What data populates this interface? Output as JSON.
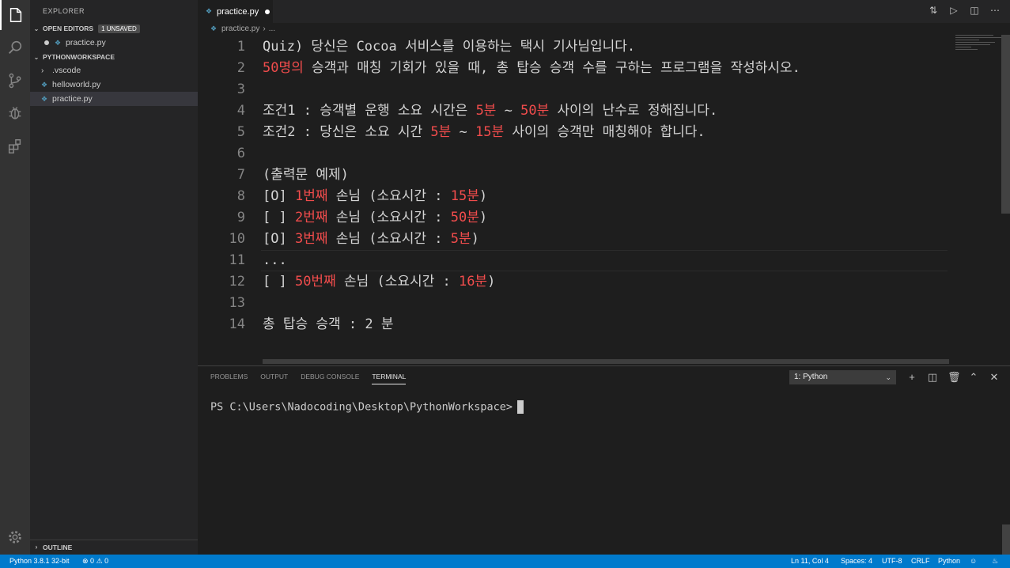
{
  "sidebar": {
    "title": "EXPLORER",
    "open_editors": {
      "label": "OPEN EDITORS",
      "badge": "1 UNSAVED",
      "files": [
        "practice.py"
      ]
    },
    "workspace": {
      "label": "PYTHONWORKSPACE",
      "items": [
        {
          "name": ".vscode",
          "type": "folder"
        },
        {
          "name": "helloworld.py",
          "type": "file"
        },
        {
          "name": "practice.py",
          "type": "file",
          "selected": true
        }
      ]
    },
    "outline_label": "OUTLINE"
  },
  "tab": {
    "label": "practice.py",
    "unsaved": true
  },
  "breadcrumb": {
    "file": "practice.py",
    "more": "..."
  },
  "editor": {
    "lines": [
      {
        "n": "1",
        "parts": [
          {
            "t": "Quiz) 당신은 Cocoa 서비스를 이용하는 택시 기사님입니다."
          }
        ]
      },
      {
        "n": "2",
        "parts": [
          {
            "t": "50명의",
            "hl": true
          },
          {
            "t": " 승객과 매칭 기회가 있을 때, 총 탑승 승객 수를 구하는 프로그램을 작성하시오."
          }
        ]
      },
      {
        "n": "3",
        "parts": []
      },
      {
        "n": "4",
        "parts": [
          {
            "t": "조건1 : 승객별 운행 소요 시간은 "
          },
          {
            "t": "5분",
            "hl": true
          },
          {
            "t": " ~ "
          },
          {
            "t": "50분",
            "hl": true
          },
          {
            "t": " 사이의 난수로 정해집니다."
          }
        ]
      },
      {
        "n": "5",
        "parts": [
          {
            "t": "조건2 : 당신은 소요 시간 "
          },
          {
            "t": "5분",
            "hl": true
          },
          {
            "t": " ~ "
          },
          {
            "t": "15분",
            "hl": true
          },
          {
            "t": " 사이의 승객만 매칭해야 합니다."
          }
        ]
      },
      {
        "n": "6",
        "parts": []
      },
      {
        "n": "7",
        "parts": [
          {
            "t": "(출력문 예제)"
          }
        ]
      },
      {
        "n": "8",
        "parts": [
          {
            "t": "[O] "
          },
          {
            "t": "1번째",
            "hl": true
          },
          {
            "t": " 손님 (소요시간 : "
          },
          {
            "t": "15분",
            "hl": true
          },
          {
            "t": ")"
          }
        ]
      },
      {
        "n": "9",
        "parts": [
          {
            "t": "[ ] "
          },
          {
            "t": "2번째",
            "hl": true
          },
          {
            "t": " 손님 (소요시간 : "
          },
          {
            "t": "50분",
            "hl": true
          },
          {
            "t": ")"
          }
        ]
      },
      {
        "n": "10",
        "parts": [
          {
            "t": "[O] "
          },
          {
            "t": "3번째",
            "hl": true
          },
          {
            "t": " 손님 (소요시간 : "
          },
          {
            "t": "5분",
            "hl": true
          },
          {
            "t": ")"
          }
        ]
      },
      {
        "n": "11",
        "parts": [
          {
            "t": "..."
          }
        ]
      },
      {
        "n": "12",
        "parts": [
          {
            "t": "[ ] "
          },
          {
            "t": "50번째",
            "hl": true
          },
          {
            "t": " 손님 (소요시간 : "
          },
          {
            "t": "16분",
            "hl": true
          },
          {
            "t": ")"
          }
        ]
      },
      {
        "n": "13",
        "parts": []
      },
      {
        "n": "14",
        "parts": [
          {
            "t": "총 탑승 승객 : 2 분"
          }
        ]
      }
    ],
    "current_line": 11
  },
  "panel": {
    "tabs": [
      "PROBLEMS",
      "OUTPUT",
      "DEBUG CONSOLE",
      "TERMINAL"
    ],
    "active_tab": "TERMINAL",
    "terminal_select": "1: Python",
    "prompt": "PS C:\\Users\\Nadocoding\\Desktop\\PythonWorkspace>"
  },
  "statusbar": {
    "interpreter": "Python 3.8.1 32-bit",
    "problems": "0",
    "warnings": "0",
    "position": "Ln 11, Col 4",
    "spaces": "Spaces: 4",
    "encoding": "UTF-8",
    "eol": "CRLF",
    "language": "Python"
  },
  "colors": {
    "accent": "#007acc",
    "highlight": "#f14c4c"
  }
}
